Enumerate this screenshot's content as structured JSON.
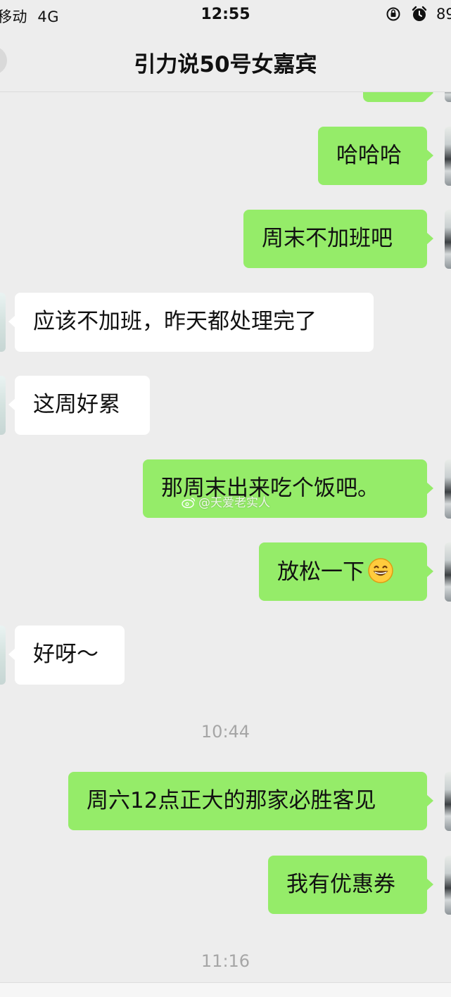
{
  "status_bar": {
    "carrier": "移动  4G",
    "time": "12:55",
    "battery": "89"
  },
  "header": {
    "title": "引力说50号女嘉宾"
  },
  "messages": [
    {
      "side": "sent",
      "text": "哈哈哈"
    },
    {
      "side": "sent",
      "text": "周末不加班吧"
    },
    {
      "side": "received",
      "text": "应该不加班，昨天都处理完了"
    },
    {
      "side": "received",
      "text": "这周好累"
    },
    {
      "side": "sent",
      "text": "那周末出来吃个饭吧。"
    },
    {
      "side": "sent",
      "text": "放松一下",
      "emoji": "grinning-face"
    },
    {
      "side": "received",
      "text": "好呀～"
    },
    {
      "side": "time",
      "text": "10:44"
    },
    {
      "side": "sent",
      "text": "周六12点正大的那家必胜客见"
    },
    {
      "side": "sent",
      "text": "我有优惠券"
    },
    {
      "side": "time",
      "text": "11:16"
    }
  ],
  "watermark": {
    "text": "@天爱老实人",
    "icon": "weibo-icon"
  },
  "colors": {
    "background": "#ededed",
    "sent_bubble": "#95ec69",
    "received_bubble": "#ffffff",
    "timestamp": "#a6a6a6"
  }
}
